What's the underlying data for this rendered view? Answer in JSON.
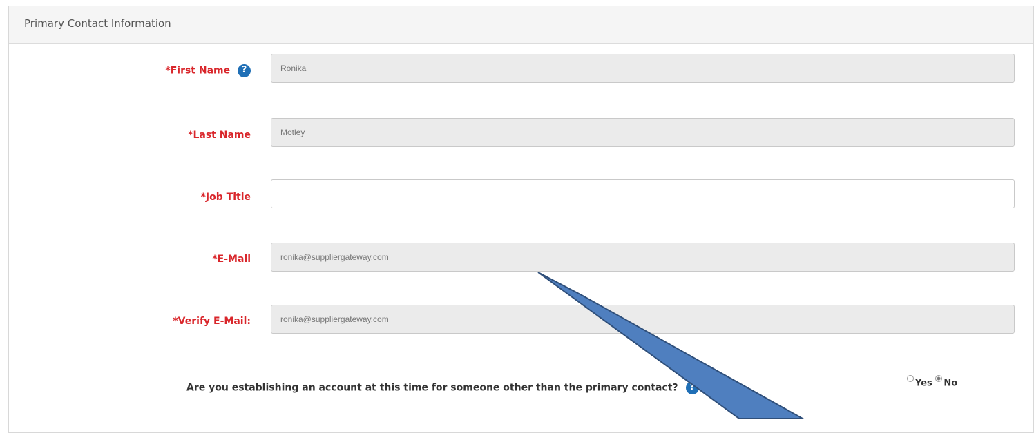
{
  "panel": {
    "title": "Primary Contact Information"
  },
  "fields": {
    "first_name": {
      "label": "*First Name",
      "value": "Ronika"
    },
    "last_name": {
      "label": "*Last Name",
      "value": "Motley"
    },
    "job_title": {
      "label": "*Job Title",
      "value": ""
    },
    "email": {
      "label": "*E-Mail",
      "value": "ronika@suppliergateway.com"
    },
    "verify_email": {
      "label": "*Verify E-Mail:",
      "value": "ronika@suppliergateway.com"
    }
  },
  "question": {
    "text": "Are you establishing an account at this time for someone other than the primary contact?",
    "options": [
      {
        "label": "Yes",
        "selected": false
      },
      {
        "label": "No",
        "selected": true
      }
    ]
  },
  "colors": {
    "required_label": "#d9262b",
    "help_icon": "#1f6fb6",
    "arrow": "#4f7fbf"
  },
  "icons": {
    "help": "help-icon",
    "annotation": "arrow-annotation"
  }
}
